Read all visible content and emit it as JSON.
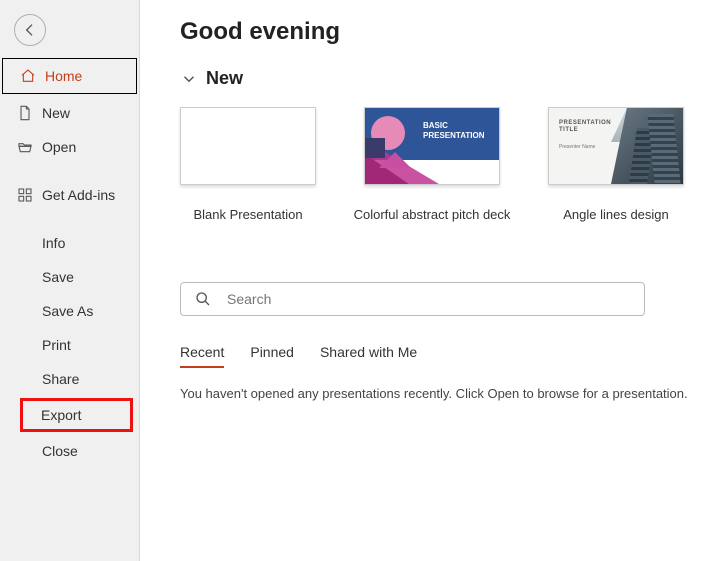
{
  "sidebar": {
    "items": [
      {
        "label": "Home"
      },
      {
        "label": "New"
      },
      {
        "label": "Open"
      },
      {
        "label": "Get Add-ins"
      },
      {
        "label": "Info"
      },
      {
        "label": "Save"
      },
      {
        "label": "Save As"
      },
      {
        "label": "Print"
      },
      {
        "label": "Share"
      },
      {
        "label": "Export"
      },
      {
        "label": "Close"
      }
    ]
  },
  "page": {
    "title": "Good evening"
  },
  "new_section": {
    "title": "New",
    "templates": [
      {
        "label": "Blank Presentation"
      },
      {
        "label": "Colorful abstract pitch deck",
        "inner_title_1": "BASIC",
        "inner_title_2": "PRESENTATION"
      },
      {
        "label": "Angle lines design",
        "inner_title_1": "PRESENTATION",
        "inner_title_2": "TITLE",
        "inner_sub": "Presenter Name"
      }
    ]
  },
  "search": {
    "placeholder": "Search",
    "value": ""
  },
  "tabs": [
    {
      "label": "Recent"
    },
    {
      "label": "Pinned"
    },
    {
      "label": "Shared with Me"
    }
  ],
  "empty_message": "You haven't opened any presentations recently. Click Open to browse for a presentation."
}
